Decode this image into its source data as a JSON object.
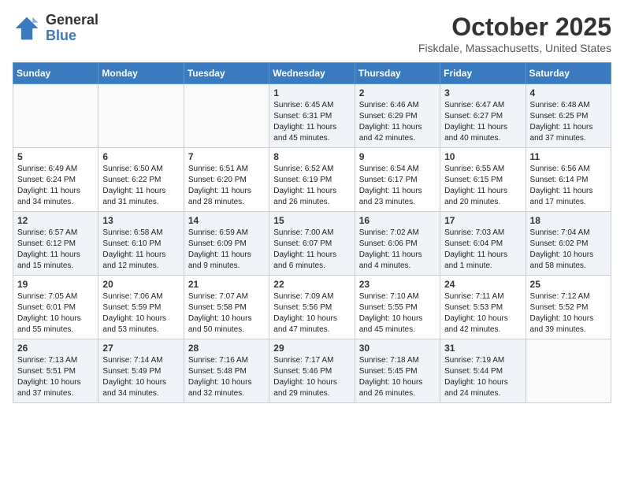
{
  "header": {
    "logo_general": "General",
    "logo_blue": "Blue",
    "month_title": "October 2025",
    "location": "Fiskdale, Massachusetts, United States"
  },
  "weekdays": [
    "Sunday",
    "Monday",
    "Tuesday",
    "Wednesday",
    "Thursday",
    "Friday",
    "Saturday"
  ],
  "weeks": [
    [
      {
        "day": "",
        "info": ""
      },
      {
        "day": "",
        "info": ""
      },
      {
        "day": "",
        "info": ""
      },
      {
        "day": "1",
        "info": "Sunrise: 6:45 AM\nSunset: 6:31 PM\nDaylight: 11 hours\nand 45 minutes."
      },
      {
        "day": "2",
        "info": "Sunrise: 6:46 AM\nSunset: 6:29 PM\nDaylight: 11 hours\nand 42 minutes."
      },
      {
        "day": "3",
        "info": "Sunrise: 6:47 AM\nSunset: 6:27 PM\nDaylight: 11 hours\nand 40 minutes."
      },
      {
        "day": "4",
        "info": "Sunrise: 6:48 AM\nSunset: 6:25 PM\nDaylight: 11 hours\nand 37 minutes."
      }
    ],
    [
      {
        "day": "5",
        "info": "Sunrise: 6:49 AM\nSunset: 6:24 PM\nDaylight: 11 hours\nand 34 minutes."
      },
      {
        "day": "6",
        "info": "Sunrise: 6:50 AM\nSunset: 6:22 PM\nDaylight: 11 hours\nand 31 minutes."
      },
      {
        "day": "7",
        "info": "Sunrise: 6:51 AM\nSunset: 6:20 PM\nDaylight: 11 hours\nand 28 minutes."
      },
      {
        "day": "8",
        "info": "Sunrise: 6:52 AM\nSunset: 6:19 PM\nDaylight: 11 hours\nand 26 minutes."
      },
      {
        "day": "9",
        "info": "Sunrise: 6:54 AM\nSunset: 6:17 PM\nDaylight: 11 hours\nand 23 minutes."
      },
      {
        "day": "10",
        "info": "Sunrise: 6:55 AM\nSunset: 6:15 PM\nDaylight: 11 hours\nand 20 minutes."
      },
      {
        "day": "11",
        "info": "Sunrise: 6:56 AM\nSunset: 6:14 PM\nDaylight: 11 hours\nand 17 minutes."
      }
    ],
    [
      {
        "day": "12",
        "info": "Sunrise: 6:57 AM\nSunset: 6:12 PM\nDaylight: 11 hours\nand 15 minutes."
      },
      {
        "day": "13",
        "info": "Sunrise: 6:58 AM\nSunset: 6:10 PM\nDaylight: 11 hours\nand 12 minutes."
      },
      {
        "day": "14",
        "info": "Sunrise: 6:59 AM\nSunset: 6:09 PM\nDaylight: 11 hours\nand 9 minutes."
      },
      {
        "day": "15",
        "info": "Sunrise: 7:00 AM\nSunset: 6:07 PM\nDaylight: 11 hours\nand 6 minutes."
      },
      {
        "day": "16",
        "info": "Sunrise: 7:02 AM\nSunset: 6:06 PM\nDaylight: 11 hours\nand 4 minutes."
      },
      {
        "day": "17",
        "info": "Sunrise: 7:03 AM\nSunset: 6:04 PM\nDaylight: 11 hours\nand 1 minute."
      },
      {
        "day": "18",
        "info": "Sunrise: 7:04 AM\nSunset: 6:02 PM\nDaylight: 10 hours\nand 58 minutes."
      }
    ],
    [
      {
        "day": "19",
        "info": "Sunrise: 7:05 AM\nSunset: 6:01 PM\nDaylight: 10 hours\nand 55 minutes."
      },
      {
        "day": "20",
        "info": "Sunrise: 7:06 AM\nSunset: 5:59 PM\nDaylight: 10 hours\nand 53 minutes."
      },
      {
        "day": "21",
        "info": "Sunrise: 7:07 AM\nSunset: 5:58 PM\nDaylight: 10 hours\nand 50 minutes."
      },
      {
        "day": "22",
        "info": "Sunrise: 7:09 AM\nSunset: 5:56 PM\nDaylight: 10 hours\nand 47 minutes."
      },
      {
        "day": "23",
        "info": "Sunrise: 7:10 AM\nSunset: 5:55 PM\nDaylight: 10 hours\nand 45 minutes."
      },
      {
        "day": "24",
        "info": "Sunrise: 7:11 AM\nSunset: 5:53 PM\nDaylight: 10 hours\nand 42 minutes."
      },
      {
        "day": "25",
        "info": "Sunrise: 7:12 AM\nSunset: 5:52 PM\nDaylight: 10 hours\nand 39 minutes."
      }
    ],
    [
      {
        "day": "26",
        "info": "Sunrise: 7:13 AM\nSunset: 5:51 PM\nDaylight: 10 hours\nand 37 minutes."
      },
      {
        "day": "27",
        "info": "Sunrise: 7:14 AM\nSunset: 5:49 PM\nDaylight: 10 hours\nand 34 minutes."
      },
      {
        "day": "28",
        "info": "Sunrise: 7:16 AM\nSunset: 5:48 PM\nDaylight: 10 hours\nand 32 minutes."
      },
      {
        "day": "29",
        "info": "Sunrise: 7:17 AM\nSunset: 5:46 PM\nDaylight: 10 hours\nand 29 minutes."
      },
      {
        "day": "30",
        "info": "Sunrise: 7:18 AM\nSunset: 5:45 PM\nDaylight: 10 hours\nand 26 minutes."
      },
      {
        "day": "31",
        "info": "Sunrise: 7:19 AM\nSunset: 5:44 PM\nDaylight: 10 hours\nand 24 minutes."
      },
      {
        "day": "",
        "info": ""
      }
    ]
  ]
}
